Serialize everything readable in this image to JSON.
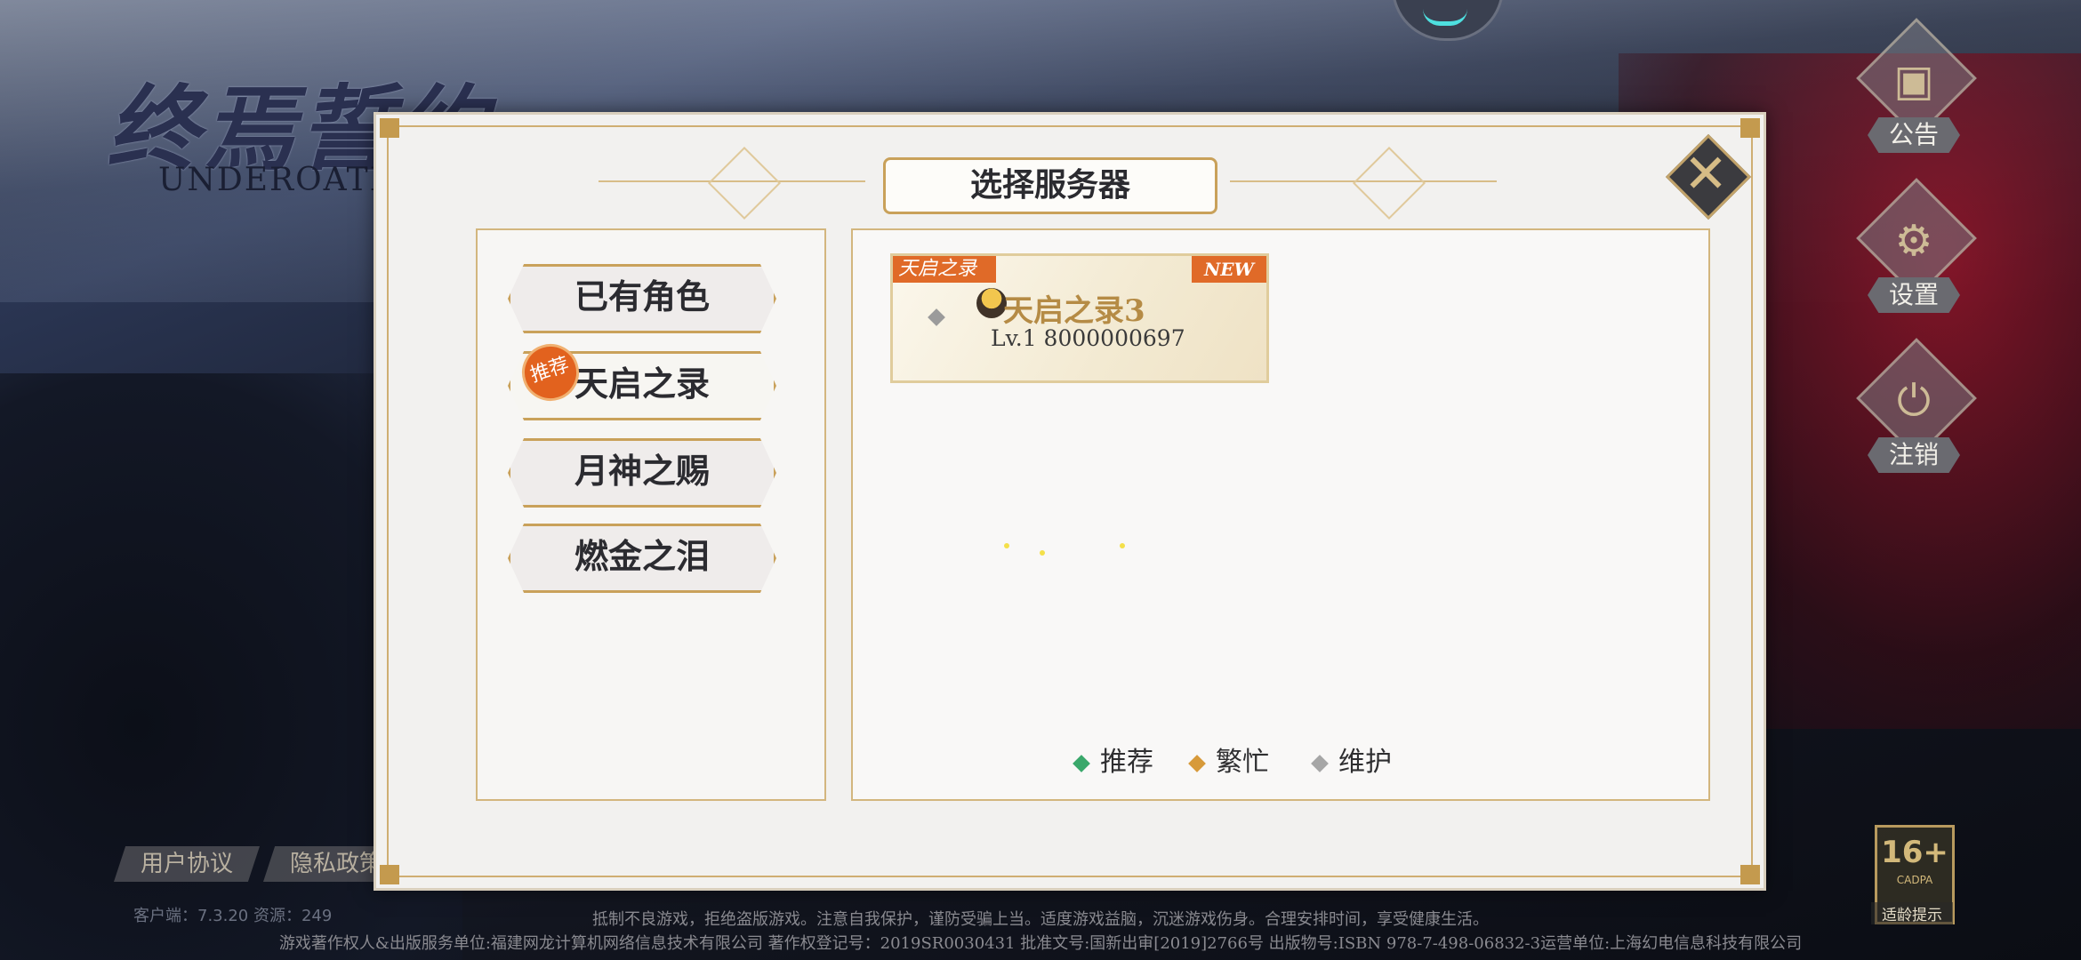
{
  "background": {
    "logo_cn": "终焉誓约",
    "logo_en": "UNDEROATH"
  },
  "side_menu": [
    {
      "label": "公告",
      "icon": "notice-board-icon"
    },
    {
      "label": "设置",
      "icon": "gear-icon"
    },
    {
      "label": "注销",
      "icon": "power-icon"
    }
  ],
  "bottom_links": {
    "user_agreement": "用户协议",
    "privacy_policy": "隐私政策"
  },
  "version_text": "客户端：7.3.20 资源：249",
  "footer": {
    "health_notice": "抵制不良游戏，拒绝盗版游戏。注意自我保护，谨防受骗上当。适度游戏益脑，沉迷游戏伤身。合理安排时间，享受健康生活。",
    "publisher_info": "游戏著作权人&出版服务单位:福建网龙计算机网络信息技术有限公司  著作权登记号：2019SR0030431  批准文号:国新出审[2019]2766号  出版物号:ISBN 978-7-498-06832-3运营单位:上海幻电信息科技有限公司"
  },
  "age_rating": {
    "number": "16+",
    "sub": "CADPA",
    "caption": "适龄提示"
  },
  "dialog": {
    "title": "选择服务器",
    "close_icon": "close-x-icon",
    "tabs": [
      {
        "label": "已有角色",
        "badge": ""
      },
      {
        "label": "天启之录",
        "badge": "推荐"
      },
      {
        "label": "月神之赐",
        "badge": ""
      },
      {
        "label": "燃金之泪",
        "badge": ""
      }
    ],
    "server_card": {
      "tag": "天启之录",
      "new_label": "NEW",
      "name": "天启之录3",
      "info": "Lv.1 8000000697",
      "status_color": "#9b9b9b"
    },
    "legend": [
      {
        "label": "推荐",
        "color": "#3aa86b"
      },
      {
        "label": "繁忙",
        "color": "#d79a3a"
      },
      {
        "label": "维护",
        "color": "#a6a6a6"
      }
    ]
  }
}
